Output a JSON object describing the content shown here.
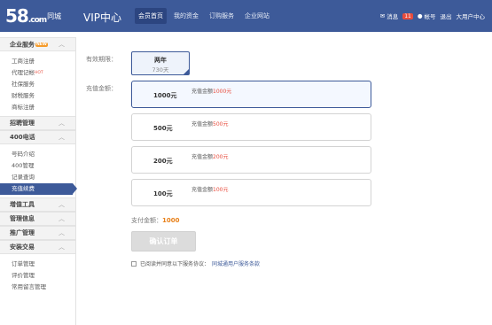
{
  "header": {
    "logo_mark": "58",
    "logo_suffix": ".com",
    "logo_city": "同城",
    "vip_title": "VIP中心",
    "nav": [
      {
        "label": "会员首页",
        "active": true
      },
      {
        "label": "我的资金",
        "active": false
      },
      {
        "label": "订购服务",
        "active": false
      },
      {
        "label": "企业网站",
        "active": false
      }
    ],
    "messages_label": "消息",
    "messages_count": "11",
    "account_label": "帐号",
    "logout_label": "退出",
    "user_label": "大用户中心"
  },
  "sidebar": {
    "sections": [
      {
        "title": "企业服务",
        "badge": "NEW",
        "items": [
          {
            "label": "工商注册"
          },
          {
            "label": "代理记帐",
            "hot": "HOT"
          },
          {
            "label": "社保服务"
          },
          {
            "label": "财税服务"
          },
          {
            "label": "商标注册"
          }
        ]
      },
      {
        "title": "招聘管理",
        "items": []
      },
      {
        "title": "400电话",
        "items": [
          {
            "label": "号码介绍"
          },
          {
            "label": "400管理"
          },
          {
            "label": "记录查询"
          },
          {
            "label": "充值续费",
            "active": true
          }
        ]
      },
      {
        "title": "增值工具",
        "items": []
      },
      {
        "title": "管理信息",
        "items": []
      },
      {
        "title": "推广管理",
        "items": []
      },
      {
        "title": "安装交易",
        "items": [
          {
            "label": "订单管理"
          },
          {
            "label": "评价管理"
          },
          {
            "label": "常用留言管理"
          }
        ]
      }
    ]
  },
  "form": {
    "period_label": "有效期限：",
    "period_value": "两年",
    "period_days": "730天",
    "amount_label": "充值金额：",
    "options": [
      {
        "amount": "1000元",
        "desc_prefix": "充值金额",
        "desc_value": "1000元",
        "selected": true
      },
      {
        "amount": "500元",
        "desc_prefix": "充值金额",
        "desc_value": "500元",
        "selected": false
      },
      {
        "amount": "200元",
        "desc_prefix": "充值金额",
        "desc_value": "200元",
        "selected": false
      },
      {
        "amount": "100元",
        "desc_prefix": "充值金额",
        "desc_value": "100元",
        "selected": false
      }
    ],
    "pay_label": "支付金额：",
    "pay_value": "1000",
    "confirm_label": "确认订单",
    "agree_text": "已阅读并同意以下服务协议：",
    "agree_link": "同城通用户服务条款"
  },
  "colors": {
    "header_bg": "#3d5a99",
    "accent_red": "#e84c3d",
    "accent_orange": "#e8811a"
  }
}
